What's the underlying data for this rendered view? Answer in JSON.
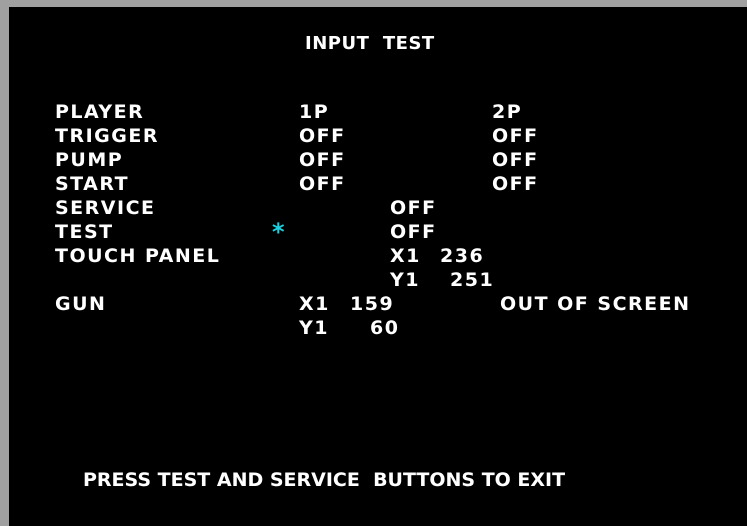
{
  "title": "INPUT  TEST",
  "rows": {
    "player": {
      "label": "PLAYER",
      "p1": "1P",
      "p2": "2P"
    },
    "trigger": {
      "label": "TRIGGER",
      "p1": "OFF",
      "p2": "OFF"
    },
    "pump": {
      "label": "PUMP",
      "p1": "OFF",
      "p2": "OFF"
    },
    "start": {
      "label": "START",
      "p1": "OFF",
      "p2": "OFF"
    },
    "service": {
      "label": "SERVICE",
      "value": "OFF"
    },
    "test": {
      "label": "TEST",
      "value": "OFF"
    },
    "touch_panel": {
      "label": "TOUCH PANEL",
      "x_label": "X1",
      "x_value": "236",
      "y_label": "Y1",
      "y_value": "251"
    },
    "gun": {
      "label": "GUN",
      "x_label": "X1",
      "x_value": "159",
      "y_label": "Y1",
      "y_value": "60",
      "p2_status": "OUT OF SCREEN"
    }
  },
  "cursor": {
    "glyph": "*",
    "color": "#19d2e0"
  },
  "footer": "PRESS TEST AND SERVICE  BUTTONS TO EXIT",
  "colors": {
    "background": "#000000",
    "text": "#ffffff",
    "border": "#a0a0a0"
  }
}
